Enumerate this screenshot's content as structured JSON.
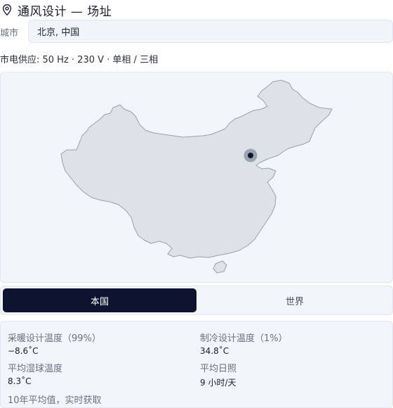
{
  "header": {
    "title": "通风设计 — 场址",
    "icon": "map-pin-icon"
  },
  "city": {
    "label": "城市",
    "value": "北京, 中国"
  },
  "power": {
    "text": "市电供应: 50 Hz · 230 V · 单相 / 三相"
  },
  "map": {
    "region": "China",
    "marker_city": "Beijing",
    "land_color": "#dde1e8",
    "border_color": "#9aa0ab",
    "marker_color": "#0e1430"
  },
  "tabs": [
    {
      "label": "本国",
      "active": true
    },
    {
      "label": "世界",
      "active": false
    }
  ],
  "stats": {
    "heating": {
      "label": "采暖设计温度（99%）",
      "value": "−8.6˚C"
    },
    "cooling": {
      "label": "制冷设计温度（1%）",
      "value": "34.8˚C"
    },
    "wetbulb": {
      "label": "平均湿球温度",
      "value": "8.3˚C"
    },
    "sunshine": {
      "label": "平均日照",
      "value": "9 小时/天"
    },
    "footnote": "10年平均值，实时获取"
  },
  "colors": {
    "accent": "#0e1430",
    "panel_bg": "#f2f5f9"
  }
}
